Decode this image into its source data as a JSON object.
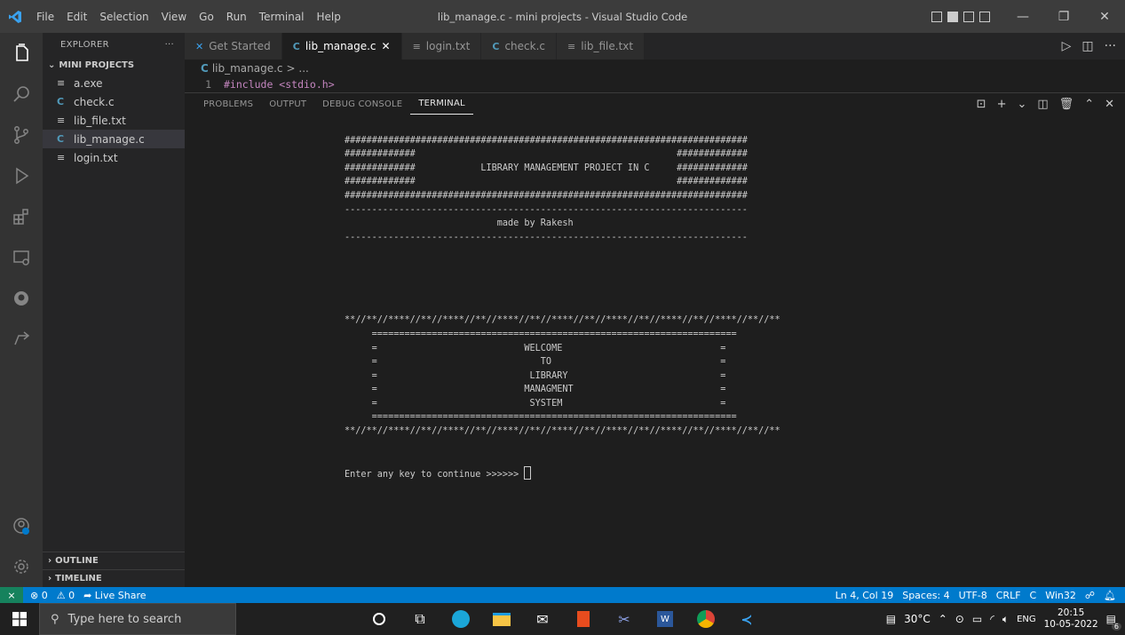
{
  "titlebar": {
    "menu": [
      "File",
      "Edit",
      "Selection",
      "View",
      "Go",
      "Run",
      "Terminal",
      "Help"
    ],
    "title": "lib_manage.c - mini projects - Visual Studio Code"
  },
  "sidebar": {
    "header": "EXPLORER",
    "header_more": "···",
    "section": "MINI PROJECTS",
    "files": [
      {
        "icon": "≡",
        "name": "a.exe"
      },
      {
        "icon": "C",
        "name": "check.c"
      },
      {
        "icon": "≡",
        "name": "lib_file.txt"
      },
      {
        "icon": "C",
        "name": "lib_manage.c"
      },
      {
        "icon": "≡",
        "name": "login.txt"
      }
    ],
    "outline": "OUTLINE",
    "timeline": "TIMELINE"
  },
  "tabs": [
    {
      "icon": "✕",
      "name": "Get Started"
    },
    {
      "icon": "C",
      "name": "lib_manage.c"
    },
    {
      "icon": "≡",
      "name": "login.txt"
    },
    {
      "icon": "C",
      "name": "check.c"
    },
    {
      "icon": "≡",
      "name": "lib_file.txt"
    }
  ],
  "active_tab_close": "✕",
  "breadcrumb": {
    "file": "lib_manage.c",
    "rest": "> ..."
  },
  "code": {
    "line_no": "1",
    "text": "#include <stdio.h>"
  },
  "panel": {
    "tabs": [
      "PROBLEMS",
      "OUTPUT",
      "DEBUG CONSOLE",
      "TERMINAL"
    ],
    "terminal_lines": [
      "##########################################################################",
      "#############                                                #############",
      "#############            LIBRARY MANAGEMENT PROJECT IN C     #############",
      "#############                                                #############",
      "##########################################################################",
      "--------------------------------------------------------------------------",
      "                            made by Rakesh",
      "--------------------------------------------------------------------------",
      "",
      "",
      "",
      "",
      "",
      "**//**//****//**//****//**//****//**//****//**//****//**//****//**//****//**//**",
      "     ===================================================================",
      "     =                           WELCOME                             =",
      "     =                              TO                               =",
      "     =                            LIBRARY                            =",
      "     =                           MANAGMENT                           =",
      "     =                            SYSTEM                             =",
      "     ===================================================================",
      "**//**//****//**//****//**//****//**//****//**//****//**//****//**//****//**//**",
      "",
      "",
      "Enter any key to continue >>>>>> "
    ]
  },
  "status": {
    "errors": "⊗ 0",
    "warnings": "⚠ 0",
    "live_share": "Live Share",
    "position": "Ln 4, Col 19",
    "spaces": "Spaces: 4",
    "encoding": "UTF-8",
    "eol": "CRLF",
    "language": "C",
    "platform": "Win32"
  },
  "taskbar": {
    "search_placeholder": "Type here to search",
    "temperature": "30°C",
    "lang": "ENG",
    "time": "20:15",
    "date": "10-05-2022",
    "notif_count": "6"
  },
  "colors": {
    "accent": "#007acc",
    "remote": "#16825d"
  }
}
